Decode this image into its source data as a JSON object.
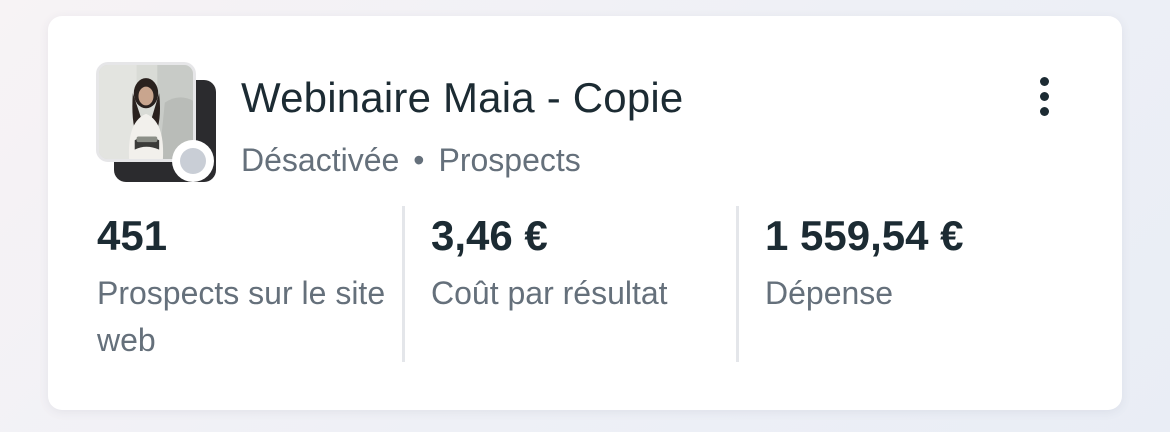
{
  "campaign": {
    "title": "Webinaire Maia - Copie",
    "status": "Désactivée",
    "separator": "•",
    "objective": "Prospects",
    "status_color": "#c9ced6"
  },
  "metrics": [
    {
      "value": "451",
      "label": "Prospects sur le site web"
    },
    {
      "value": "3,46 €",
      "label": "Coût par résultat"
    },
    {
      "value": "1 559,54 €",
      "label": "Dépense"
    }
  ],
  "icons": {
    "menu": "more-vertical-icon",
    "thumbnail": "ad-thumbnail-photo"
  }
}
